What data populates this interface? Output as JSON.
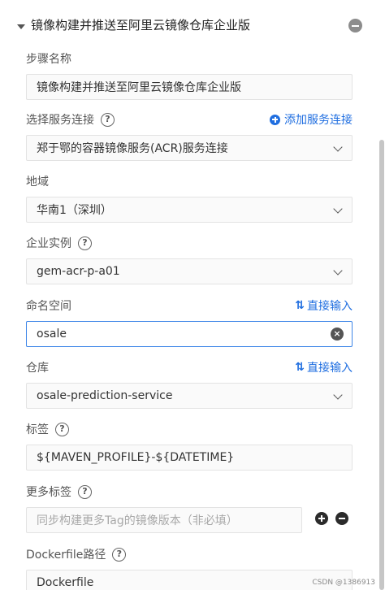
{
  "step": {
    "title": "镜像构建并推送至阿里云镜像仓库企业版"
  },
  "fields": {
    "step_name": {
      "label": "步骤名称",
      "value": "镜像构建并推送至阿里云镜像仓库企业版"
    },
    "service_connection": {
      "label": "选择服务连接",
      "help": "?",
      "action": "添加服务连接",
      "value": "郑于鄂的容器镜像服务(ACR)服务连接"
    },
    "region": {
      "label": "地域",
      "value": "华南1（深圳）"
    },
    "enterprise_instance": {
      "label": "企业实例",
      "help": "?",
      "value": "gem-acr-p-a01"
    },
    "namespace": {
      "label": "命名空间",
      "action_icon": "⇅",
      "action": "直接输入",
      "value": "osale",
      "clear": "×"
    },
    "repository": {
      "label": "仓库",
      "action_icon": "⇅",
      "action": "直接输入",
      "value": "osale-prediction-service"
    },
    "tag": {
      "label": "标签",
      "help": "?",
      "value": "${MAVEN_PROFILE}-${DATETIME}"
    },
    "more_tags": {
      "label": "更多标签",
      "help": "?",
      "placeholder": "同步构建更多Tag的镜像版本（非必填）"
    },
    "dockerfile_path": {
      "label": "Dockerfile路径",
      "help": "?",
      "value": "Dockerfile"
    }
  },
  "watermark": "CSDN @1386913",
  "icons": {
    "caret": "caret-down-icon",
    "remove": "minus-circle-icon",
    "add_connection": "plus-circle-icon",
    "switch_input": "swap-vertical-icon",
    "clear": "clear-circle-icon",
    "select": "chevron-down-icon"
  }
}
